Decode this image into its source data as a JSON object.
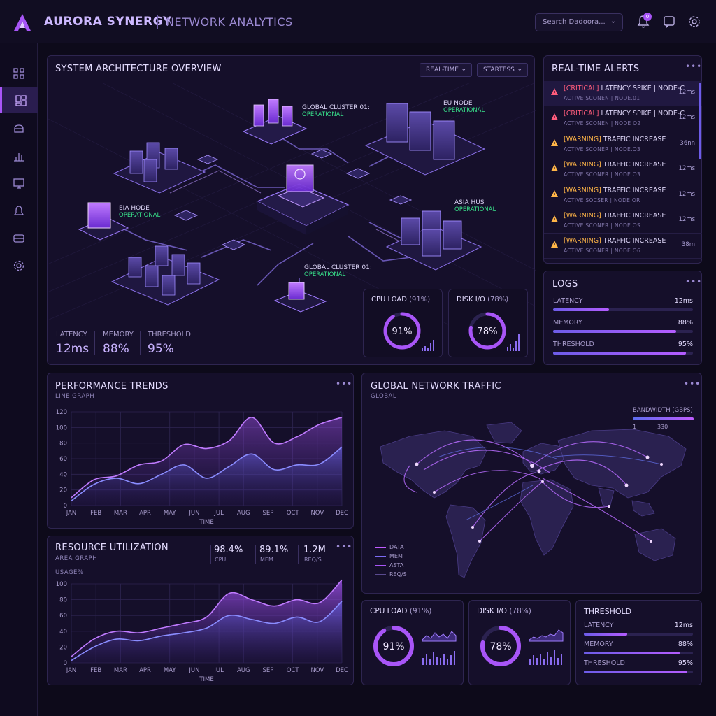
{
  "header": {
    "brand": "AURORA SYNERGY",
    "subtitle": "NETWORK ANALYTICS",
    "search_placeholder": "Search Dadoora...",
    "notification_count": "0"
  },
  "sidebar": {
    "items": [
      {
        "icon": "grid-icon"
      },
      {
        "icon": "dashboard-icon",
        "active": true
      },
      {
        "icon": "database-icon"
      },
      {
        "icon": "bar-chart-icon"
      },
      {
        "icon": "monitor-icon"
      },
      {
        "icon": "bell-icon"
      },
      {
        "icon": "layers-icon"
      },
      {
        "icon": "settings-icon"
      }
    ]
  },
  "architecture": {
    "title": "SYSTEM ARCHITECTURE OVERVIEW",
    "controls": {
      "realtime": "REAL-TIME",
      "status": "STARTESS"
    },
    "nodes": [
      {
        "name": "GLOBAL CLUSTER 01:",
        "status": "OPERATIONAL"
      },
      {
        "name": "EU NODE",
        "status": "OPERATIONAL"
      },
      {
        "name": "EIA HODE",
        "status": "OPERATIONAL"
      },
      {
        "name": "ASIA HUS",
        "status": "OPERATIONAL"
      },
      {
        "name": "GLOBAL CLUSTER 01:",
        "status": "OPERATIONAL"
      }
    ],
    "metrics": [
      {
        "label": "LATENCY",
        "value": "12ms"
      },
      {
        "label": "MEMORY",
        "value": "88%"
      },
      {
        "label": "THRESHOLD",
        "value": "95%"
      }
    ],
    "gauges": [
      {
        "label": "CPU LOAD",
        "pct_label": "(91%)",
        "value": "91%",
        "fraction": 0.91
      },
      {
        "label": "DISK I/O",
        "pct_label": "(78%)",
        "value": "78%",
        "fraction": 0.78
      }
    ]
  },
  "alerts": {
    "title": "REAL-TIME ALERTS",
    "items": [
      {
        "tag": "[CRITICAL]",
        "level": "critical",
        "text": "LATENCY SPIKE | NODE-C",
        "sub": "ACTIVE SCONEN | NODE.01",
        "time": "12ms"
      },
      {
        "tag": "[CRITICAL]",
        "level": "critical",
        "text": "LATENCY SPIKE | NODE-C",
        "sub": "ACTIVE SCONEN | NODE O2",
        "time": "12ms"
      },
      {
        "tag": "[WARNING]",
        "level": "warning",
        "text": "TRAFFIC INCREASE",
        "sub": "ACTIVE SCONER | NODE.O3",
        "time": "36nn"
      },
      {
        "tag": "[WARNING]",
        "level": "warning",
        "text": "TRAFFIC INCREASE",
        "sub": "ACTIVE SCONER | NODE O3",
        "time": "12ms"
      },
      {
        "tag": "[WARNING]",
        "level": "warning",
        "text": "TRAFFIC INCREASE",
        "sub": "ACTIVE SOCSER | NODE OR",
        "time": "12ms"
      },
      {
        "tag": "[WARNING]",
        "level": "warning",
        "text": "TRAFFIC INCREASE",
        "sub": "ACTIVE SCONER | NODE OS",
        "time": "12ms"
      },
      {
        "tag": "[WARNING]",
        "level": "warning",
        "text": "TRAFFIC INCREASE",
        "sub": "ACTIVE SCONER | NODE O6",
        "time": "38m"
      }
    ]
  },
  "logs": {
    "title": "LOGS",
    "rows": [
      {
        "label": "LATENCY",
        "value": "12ms",
        "fraction": 0.4
      },
      {
        "label": "MEMORY",
        "value": "88%",
        "fraction": 0.88
      },
      {
        "label": "THRESHOLD",
        "value": "95%",
        "fraction": 0.95
      }
    ]
  },
  "performance": {
    "title": "PERFORMANCE TRENDS",
    "subtitle": "LINE GRAPH",
    "xlabel": "TIME"
  },
  "resource": {
    "title": "RESOURCE UTILIZATION",
    "subtitle": "AREA GRAPH",
    "ylabel": "USAGE%",
    "xlabel": "TIME",
    "stats": [
      {
        "value": "98.4%",
        "label": "CPU"
      },
      {
        "value": "89.1%",
        "label": "MEM"
      },
      {
        "value": "1.2M",
        "label": "REQ/S"
      }
    ]
  },
  "traffic": {
    "title": "GLOBAL NETWORK TRAFFIC",
    "subtitle": "GLOBAL",
    "bandwidth_label": "BANDWIDTH (GBPS)",
    "bandwidth_min": "1",
    "bandwidth_max": "330",
    "legend": [
      "DATA",
      "MEM",
      "ASTA",
      "REQ/S"
    ]
  },
  "bottom": {
    "cpu": {
      "label": "CPU LOAD",
      "pct_label": "(91%)",
      "value": "91%",
      "fraction": 0.91
    },
    "disk": {
      "label": "DISK I/O",
      "pct_label": "(78%)",
      "value": "78%",
      "fraction": 0.78
    },
    "threshold": {
      "title": "THRESHOLD",
      "rows": [
        {
          "label": "LATENCY",
          "value": "12ms",
          "fraction": 0.4
        },
        {
          "label": "MEMORY",
          "value": "88%",
          "fraction": 0.88
        },
        {
          "label": "THRESHOLD",
          "value": "95%",
          "fraction": 0.95
        }
      ]
    }
  },
  "colors": {
    "accent": "#a855f7",
    "accent2": "#7c6cf5",
    "critical": "#ff5c7c",
    "warning": "#ffb547",
    "ok": "#38e08a"
  },
  "chart_data": [
    {
      "type": "line",
      "title": "PERFORMANCE TRENDS",
      "xlabel": "TIME",
      "categories": [
        "JAN",
        "FEB",
        "MAR",
        "APR",
        "MAY",
        "JUN",
        "JUL",
        "AUG",
        "SEP",
        "OCT",
        "NOV",
        "DEC"
      ],
      "ylim": [
        0,
        120
      ],
      "yticks": [
        0,
        20,
        40,
        60,
        80,
        100,
        120
      ],
      "grid": true,
      "series": [
        {
          "values": [
            10,
            33,
            38,
            52,
            57,
            78,
            73,
            83,
            113,
            80,
            88,
            104,
            113
          ]
        },
        {
          "values": [
            6,
            27,
            35,
            28,
            40,
            52,
            35,
            50,
            66,
            46,
            52,
            53,
            75
          ]
        }
      ]
    },
    {
      "type": "area",
      "title": "RESOURCE UTILIZATION",
      "ylabel": "USAGE%",
      "xlabel": "TIME",
      "categories": [
        "JAN",
        "FEB",
        "MAR",
        "APR",
        "MAY",
        "JUN",
        "JUL",
        "AUG",
        "SEP",
        "OCT",
        "NOV",
        "DEC"
      ],
      "ylim": [
        0,
        100
      ],
      "yticks": [
        0,
        20,
        40,
        60,
        80,
        100
      ],
      "grid": true,
      "series": [
        {
          "values": [
            8,
            30,
            40,
            38,
            44,
            50,
            58,
            88,
            80,
            72,
            80,
            76,
            106
          ]
        },
        {
          "values": [
            3,
            20,
            30,
            28,
            34,
            38,
            44,
            60,
            55,
            50,
            58,
            52,
            78
          ]
        }
      ]
    }
  ]
}
